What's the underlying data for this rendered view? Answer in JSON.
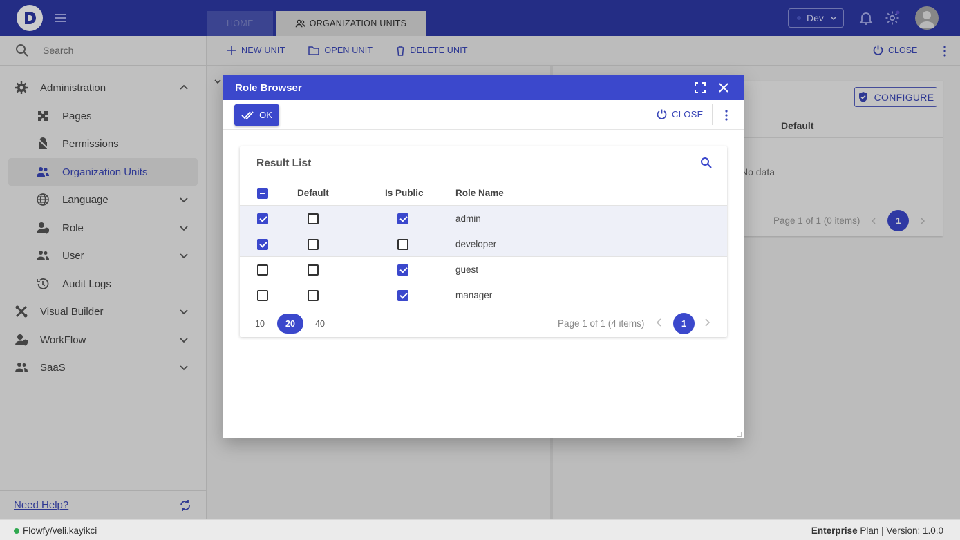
{
  "topbar": {
    "tabs": [
      {
        "label": "HOME"
      },
      {
        "label": "ORGANIZATION UNITS"
      }
    ],
    "environment": "Dev"
  },
  "sidebar": {
    "search_placeholder": "Search",
    "items": [
      {
        "label": "Administration",
        "icon": "gear-icon",
        "expanded": true
      },
      {
        "label": "Pages",
        "icon": "puzzle-icon"
      },
      {
        "label": "Permissions",
        "icon": "lock-icon"
      },
      {
        "label": "Organization Units",
        "icon": "users-icon",
        "active": true
      },
      {
        "label": "Language",
        "icon": "globe-icon"
      },
      {
        "label": "Role",
        "icon": "shield-user-icon"
      },
      {
        "label": "User",
        "icon": "users-icon"
      },
      {
        "label": "Audit Logs",
        "icon": "history-icon"
      },
      {
        "label": "Visual Builder",
        "icon": "tools-icon"
      },
      {
        "label": "WorkFlow",
        "icon": "workflow-icon"
      },
      {
        "label": "SaaS",
        "icon": "users-icon"
      }
    ],
    "help_label": "Need Help?"
  },
  "main": {
    "toolbar": {
      "new_unit": "NEW UNIT",
      "open_unit": "OPEN UNIT",
      "delete_unit": "DELETE UNIT",
      "close": "CLOSE"
    },
    "right_panel": {
      "configure": "CONFIGURE",
      "column": "Default",
      "empty": "No data",
      "page_info": "Page 1 of 1 (0 items)",
      "page": "1"
    }
  },
  "dialog": {
    "title": "Role Browser",
    "ok": "OK",
    "close": "CLOSE",
    "result_title": "Result List",
    "columns": [
      "Default",
      "Is Public",
      "Role Name"
    ],
    "rows": [
      {
        "selected": true,
        "default": false,
        "is_public": true,
        "role": "admin"
      },
      {
        "selected": true,
        "default": false,
        "is_public": false,
        "role": "developer"
      },
      {
        "selected": false,
        "default": false,
        "is_public": true,
        "role": "guest"
      },
      {
        "selected": false,
        "default": false,
        "is_public": true,
        "role": "manager"
      }
    ],
    "page_sizes": [
      "10",
      "20",
      "40"
    ],
    "active_page_size": "20",
    "page_info": "Page 1 of 1 (4 items)",
    "page": "1"
  },
  "statusbar": {
    "user": "Flowfy/veli.kayikci",
    "plan_bold": "Enterprise",
    "plan_rest": " Plan | Version: 1.0.0"
  },
  "colors": {
    "primary": "#3b48cc",
    "topbar": "#2d39a7",
    "status_online": "#2fa84f"
  }
}
